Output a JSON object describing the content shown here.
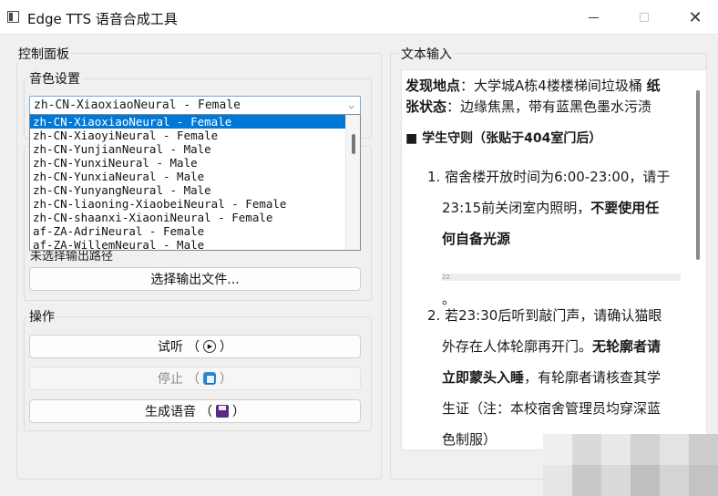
{
  "window": {
    "title": "Edge TTS 语音合成工具",
    "close_glyph": "✕"
  },
  "control_panel": {
    "title": "控制面板",
    "voice_group": {
      "title": "音色设置",
      "selected_voice": "zh-CN-XiaoxiaoNeural - Female",
      "dropdown_arrow": "⌵",
      "options": [
        "zh-CN-XiaoxiaoNeural - Female",
        "zh-CN-XiaoyiNeural - Female",
        "zh-CN-YunjianNeural - Male",
        "zh-CN-YunxiNeural - Male",
        "zh-CN-YunxiaNeural - Male",
        "zh-CN-YunyangNeural - Male",
        "zh-CN-liaoning-XiaobeiNeural - Female",
        "zh-CN-shaanxi-XiaoniNeural - Female",
        "af-ZA-AdriNeural - Female",
        "af-ZA-WillemNeural - Male"
      ]
    },
    "output": {
      "status": "未选择输出路径",
      "choose_button": "选择输出文件..."
    },
    "actions": {
      "title": "操作",
      "listen_button": "试听",
      "stop_button": "停止",
      "generate_button": "生成语音",
      "paren_open": "（",
      "paren_close": "）",
      "play_glyph": "▶"
    }
  },
  "text_input": {
    "title": "文本输入",
    "line1_label": "发现地点",
    "line1_text": "：大学城A栋4楼楼梯间垃圾桶",
    "line1_tail": "纸",
    "line2_label": "张状态",
    "line2_text": "：边缘焦黑，带有蓝黑色墨水污渍",
    "section_bullet": "■",
    "section_title": "学生守则（张贴于404室门后）",
    "rule1_num": "1.",
    "rule1_l1": "宿舍楼开放时间为6:00-23:00，请于",
    "rule1_l2a": "23:15前关闭室内照明，",
    "rule1_l2b": "不要使用任",
    "rule1_l3": "何自备光源",
    "marker": "22",
    "period": "。",
    "rule2_num": "2.",
    "rule2_l1": "若23:30后听到敲门声，请确认猫眼",
    "rule2_l2a": "外存在人体轮廓再开门。",
    "rule2_l2b": "无轮廓者请",
    "rule2_l3a": "立即蒙头入睡",
    "rule2_l3b": "，有轮廓者请核查其学",
    "rule2_l4": "生证（注：本校宿舍管理员均穿深蓝",
    "rule2_l5": "色制服）"
  },
  "colors": {
    "selection": "#0078d7",
    "window_bg": "#f0f0f0",
    "stop_icon": "#2a8bd6",
    "save_icon": "#5b2a86"
  }
}
